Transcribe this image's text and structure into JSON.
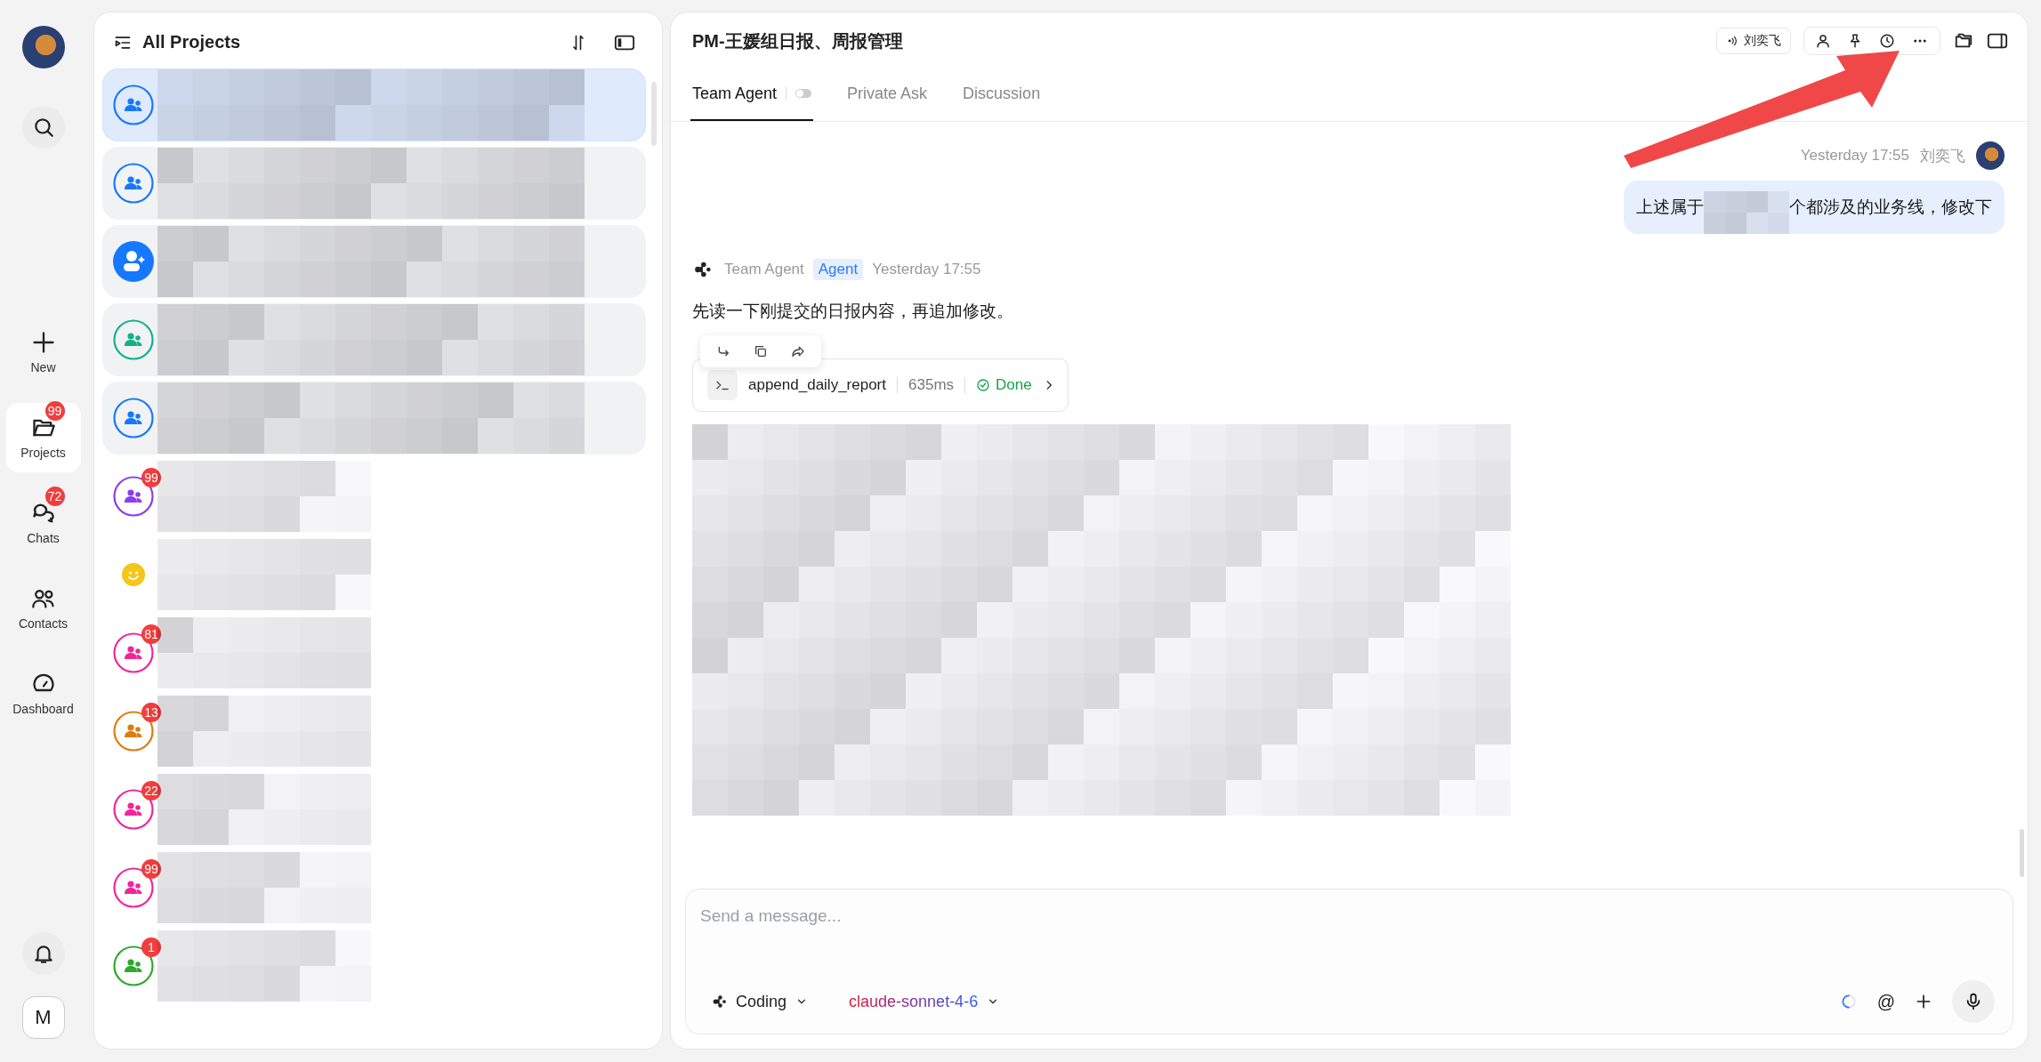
{
  "rail": {
    "nav": [
      {
        "kind": "new",
        "label": "New",
        "selected": false
      },
      {
        "kind": "projects",
        "label": "Projects",
        "selected": true,
        "badge": "99"
      },
      {
        "kind": "chats",
        "label": "Chats",
        "selected": false,
        "badge": "72"
      },
      {
        "kind": "contacts",
        "label": "Contacts",
        "selected": false
      },
      {
        "kind": "dashboard",
        "label": "Dashboard",
        "selected": false
      }
    ],
    "account": "M"
  },
  "projects": {
    "title": "All Projects",
    "items": [
      {
        "kind": "group",
        "color": "#1677ff",
        "selected": true,
        "pinned": true
      },
      {
        "kind": "group",
        "color": "#1677ff",
        "selected": false,
        "pinned": true
      },
      {
        "kind": "agent",
        "color": "#1677ff",
        "selected": false,
        "pinned": true
      },
      {
        "kind": "group",
        "color": "#14b08a",
        "selected": false,
        "pinned": true
      },
      {
        "kind": "group",
        "color": "#1677ff",
        "selected": false,
        "pinned": true
      },
      {
        "kind": "group",
        "color": "#8b3cf0",
        "selected": false,
        "pinned": false,
        "badge": "99"
      },
      {
        "kind": "emoji",
        "color": "#f5c518",
        "selected": false,
        "pinned": false
      },
      {
        "kind": "group",
        "color": "#f0269b",
        "selected": false,
        "pinned": false,
        "badge": "81"
      },
      {
        "kind": "group",
        "color": "#e07b0c",
        "selected": false,
        "pinned": false,
        "badge": "13"
      },
      {
        "kind": "group",
        "color": "#f0269b",
        "selected": false,
        "pinned": false,
        "badge": "22"
      },
      {
        "kind": "group",
        "color": "#f0269b",
        "selected": false,
        "pinned": false,
        "badge": "99"
      },
      {
        "kind": "group",
        "color": "#2ea82e",
        "selected": false,
        "pinned": false,
        "badge": "1"
      }
    ]
  },
  "chat": {
    "title": "PM-王媛组日报、周报管理",
    "speaker": "刘奕飞",
    "tabs": [
      {
        "label": "Team Agent",
        "selected": true,
        "toggle": false
      },
      {
        "label": "Private Ask",
        "selected": false
      },
      {
        "label": "Discussion",
        "selected": false
      }
    ],
    "messages": [
      {
        "kind": "user",
        "time": "Yesterday 17:55",
        "author": "刘奕飞",
        "text_before": "上述属于",
        "text_after": "个都涉及的业务线，修改下"
      },
      {
        "kind": "agent",
        "author": "Team Agent",
        "tag": "Agent",
        "time": "Yesterday 17:55",
        "text": "先读一下刚提交的日报内容，再追加修改。",
        "tool": {
          "name": "append_daily_report",
          "duration": "635ms",
          "status": "Done"
        }
      }
    ],
    "composer": {
      "placeholder": "Send a message...",
      "mode": "Coding",
      "model": "claude-sonnet-4-6",
      "mention": "@"
    }
  }
}
